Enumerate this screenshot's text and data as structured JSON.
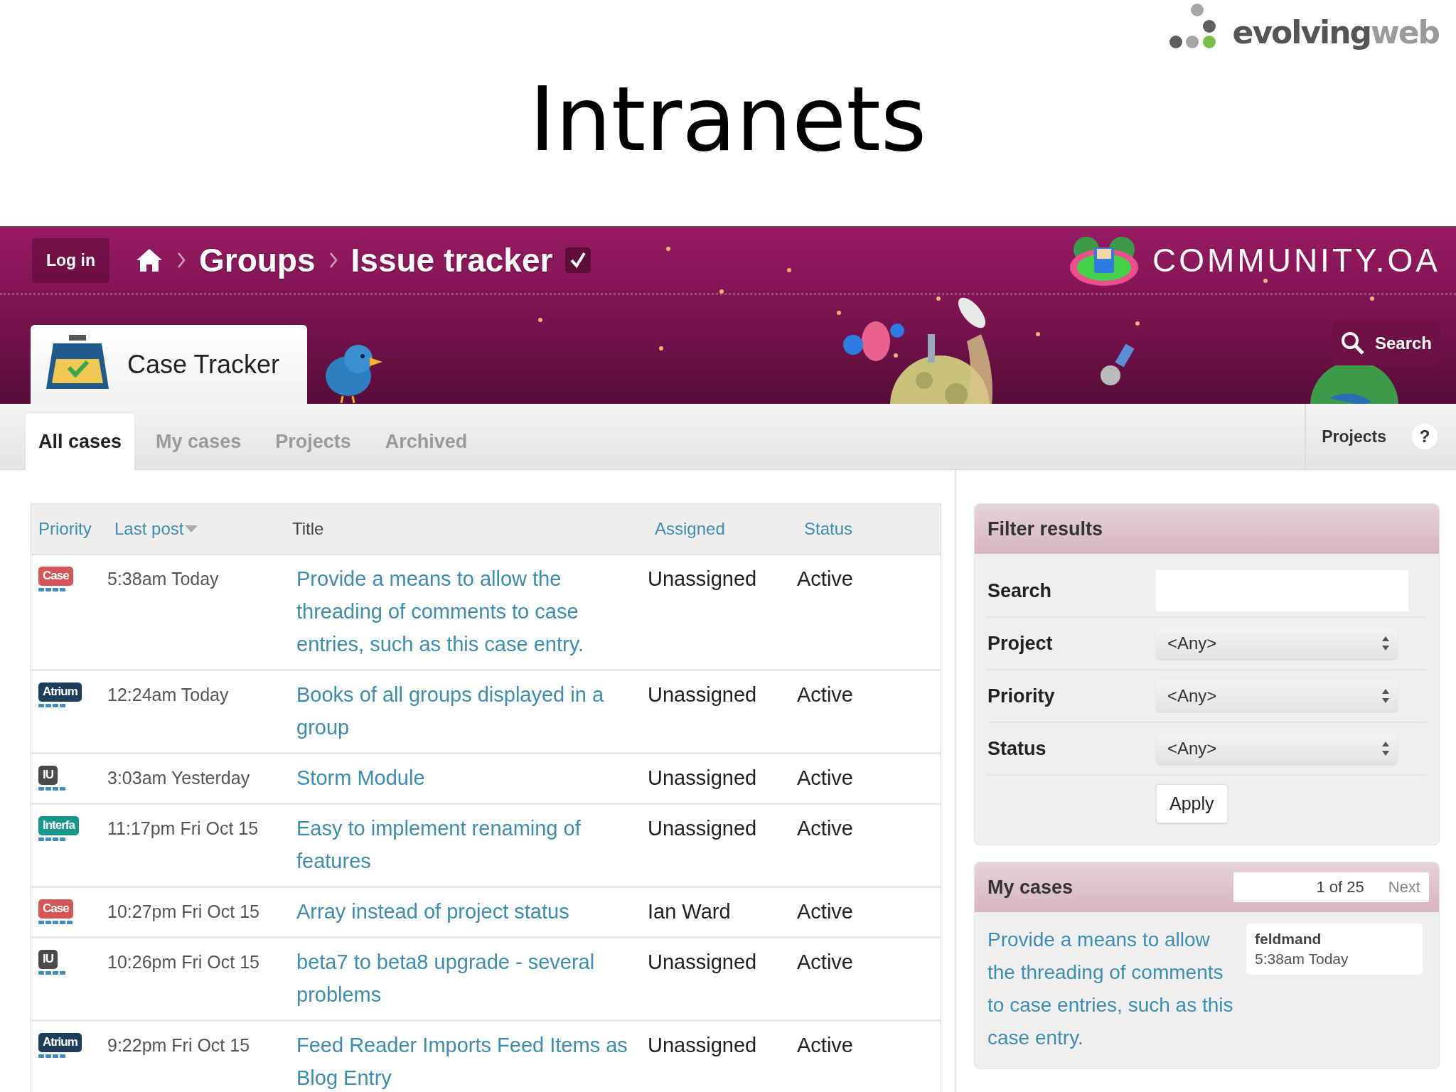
{
  "slide": {
    "logo": {
      "text": "evolving",
      "suffix": "web"
    },
    "title": "Intranets"
  },
  "header": {
    "login": "Log in",
    "breadcrumb": [
      "Groups",
      "Issue tracker"
    ],
    "site_name": "COMMUNITY.OA",
    "search": "Search",
    "app_tab": "Case Tracker"
  },
  "tabs": [
    {
      "label": "All cases",
      "selected": true
    },
    {
      "label": "My cases",
      "selected": false
    },
    {
      "label": "Projects",
      "selected": false
    },
    {
      "label": "Archived",
      "selected": false
    }
  ],
  "toolbar": {
    "link": "Projects",
    "help": "?"
  },
  "table": {
    "columns": [
      {
        "label": "Priority",
        "sortable": true,
        "sorted": false
      },
      {
        "label": "Last post",
        "sortable": true,
        "sorted": true
      },
      {
        "label": "Title",
        "sortable": false,
        "sorted": false
      },
      {
        "label": "Assigned",
        "sortable": true,
        "sorted": false
      },
      {
        "label": "Status",
        "sortable": true,
        "sorted": false
      }
    ],
    "rows": [
      {
        "tag": "Case",
        "color": "#d45656",
        "stars": 4,
        "last_post": "5:38am Today",
        "title": "Provide a means to allow the threading of comments to case entries, such as this case entry.",
        "assigned": "Unassigned",
        "status": "Active"
      },
      {
        "tag": "Atrium",
        "color": "#1e3d5c",
        "stars": 4,
        "last_post": "12:24am Today",
        "title": "Books of all groups displayed in a group",
        "assigned": "Unassigned",
        "status": "Active"
      },
      {
        "tag": "IU",
        "color": "#4a4a4a",
        "stars": 4,
        "last_post": "3:03am Yesterday",
        "title": "Storm Module",
        "assigned": "Unassigned",
        "status": "Active"
      },
      {
        "tag": "Interfa",
        "color": "#17968a",
        "stars": 4,
        "last_post": "11:17pm Fri Oct 15",
        "title": "Easy to implement renaming of features",
        "assigned": "Unassigned",
        "status": "Active"
      },
      {
        "tag": "Case",
        "color": "#d45656",
        "stars": 5,
        "last_post": "10:27pm Fri Oct 15",
        "title": "Array instead of project status",
        "assigned": "Ian Ward",
        "status": "Active"
      },
      {
        "tag": "IU",
        "color": "#4a4a4a",
        "stars": 4,
        "last_post": "10:26pm Fri Oct 15",
        "title": "beta7 to beta8 upgrade - several problems",
        "assigned": "Unassigned",
        "status": "Active"
      },
      {
        "tag": "Atrium",
        "color": "#1e3d5c",
        "stars": 4,
        "last_post": "9:22pm Fri Oct 15",
        "title": "Feed Reader Imports Feed Items as Blog Entry",
        "assigned": "Unassigned",
        "status": "Active"
      }
    ]
  },
  "filter": {
    "title": "Filter results",
    "fields": [
      {
        "kind": "text",
        "label": "Search"
      },
      {
        "kind": "select",
        "label": "Project",
        "value": "<Any>"
      },
      {
        "kind": "select",
        "label": "Priority",
        "value": "<Any>"
      },
      {
        "kind": "select",
        "label": "Status",
        "value": "<Any>"
      }
    ],
    "apply": "Apply"
  },
  "my_cases": {
    "title": "My cases",
    "pager": "1 of 25",
    "next": "Next",
    "items": [
      {
        "title": "Provide a means to allow the threading of comments to case entries, such as this case entry.",
        "user": "feldmand",
        "time": "5:38am Today"
      }
    ]
  }
}
